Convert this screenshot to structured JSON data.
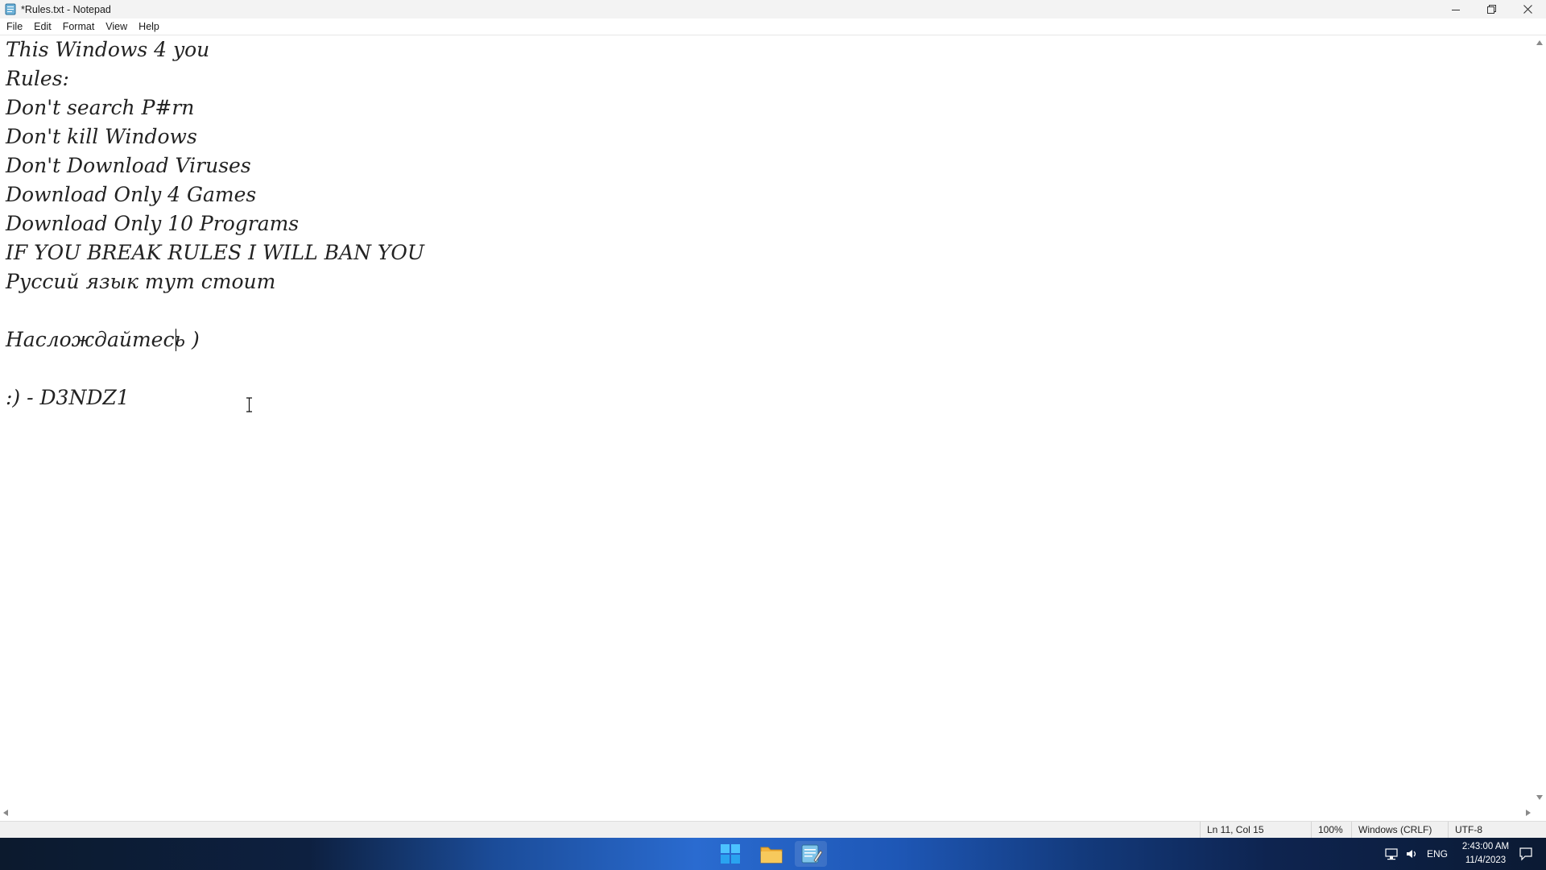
{
  "window": {
    "title": "*Rules.txt - Notepad",
    "controls": [
      "minimize",
      "restore",
      "close"
    ]
  },
  "menu": [
    "File",
    "Edit",
    "Format",
    "View",
    "Help"
  ],
  "editor": {
    "lines": [
      "This Windows 4 you",
      "Rules:",
      "Don't search P#rn",
      "Don't kill Windows",
      "Don't Download Viruses",
      "Download Only 4 Games",
      "Download Only 10 Programs",
      "IF YOU BREAK RULES I WILL BAN YOU",
      "Руссий язык тут стоит",
      "",
      "Наслождайтесь )",
      "",
      ":) - D3NDZ1"
    ]
  },
  "status": {
    "position": "Ln 11, Col 15",
    "zoom": "100%",
    "line_ending": "Windows (CRLF)",
    "encoding": "UTF-8"
  },
  "taskbar": {
    "apps": [
      "start-icon",
      "file-explorer-icon",
      "notepad-icon"
    ],
    "tray": {
      "language": "ENG",
      "time": "2:43:00 AM",
      "date": "11/4/2023"
    }
  },
  "colors": {
    "accent": "#0078d4",
    "folder": "#f2b33d"
  }
}
